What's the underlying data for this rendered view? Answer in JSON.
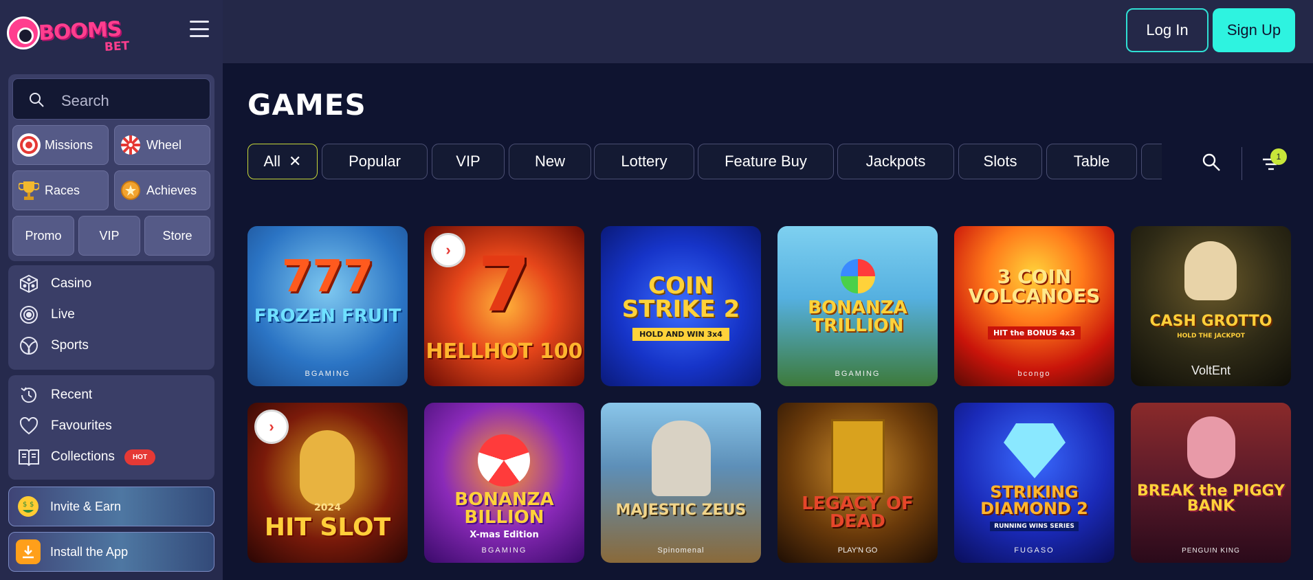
{
  "brand": {
    "name": "BOOMS",
    "suffix": "BET"
  },
  "search": {
    "placeholder": "Search"
  },
  "quick_tiles": {
    "missions": "Missions",
    "wheel": "Wheel",
    "races": "Races",
    "achieves": "Achieves",
    "promo": "Promo",
    "vip": "VIP",
    "store": "Store"
  },
  "nav_main": [
    "Casino",
    "Live",
    "Sports"
  ],
  "nav_secondary": {
    "recent": "Recent",
    "favourites": "Favourites",
    "collections": "Collections",
    "hot_badge": "HOT"
  },
  "promos": {
    "invite": "Invite & Earn",
    "install": "Install the App"
  },
  "header": {
    "login": "Log In",
    "signup": "Sign Up"
  },
  "page": {
    "title": "GAMES"
  },
  "filters": [
    "All",
    "Popular",
    "VIP",
    "New",
    "Lottery",
    "Feature Buy",
    "Jackpots",
    "Slots",
    "Table"
  ],
  "filter_badge_count": "1",
  "games": [
    {
      "title": "FROZEN FRUIT",
      "provider": "BGAMING"
    },
    {
      "title": "HELLHOT 100",
      "provider": ""
    },
    {
      "title": "COIN STRIKE 2",
      "provider": "",
      "tag": "HOLD AND WIN 3x4"
    },
    {
      "title": "BONANZA TRILLION",
      "provider": "BGAMING"
    },
    {
      "title": "3 COIN VOLCANOES",
      "provider": "bcongo",
      "tag": "HIT the BONUS 4x3"
    },
    {
      "title": "CASH GROTTO",
      "provider": "VoltEnt",
      "tag": "HOLD THE JACKPOT"
    },
    {
      "title": "HIT SLOT",
      "provider": "",
      "tag": "2024"
    },
    {
      "title": "BONANZA BILLION",
      "provider": "BGAMING",
      "tag": "X-mas Edition"
    },
    {
      "title": "MAJESTIC ZEUS",
      "provider": "Spinomenal"
    },
    {
      "title": "LEGACY OF DEAD",
      "provider": "PLAY'N GO"
    },
    {
      "title": "STRIKING DIAMOND 2",
      "provider": "FUGASO",
      "tag": "RUNNING WINS SERIES"
    },
    {
      "title": "BREAK the PIGGY BANK",
      "provider": "PENGUIN KING"
    }
  ],
  "colors": {
    "accent": "#2ef3e0",
    "active_chip": "#c8d93a",
    "brand": "#ff3e8e",
    "hot": "#e53935"
  }
}
